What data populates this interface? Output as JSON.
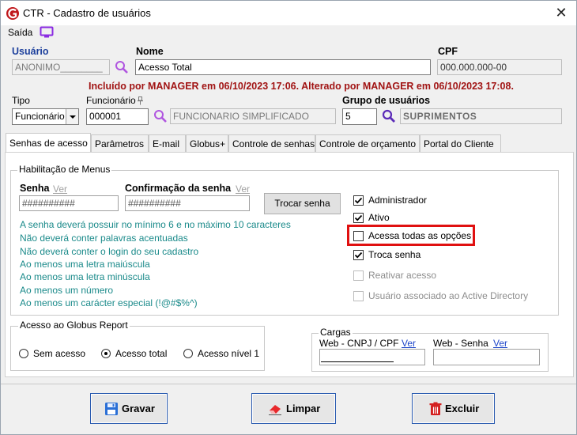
{
  "window": {
    "title": "CTR - Cadastro de usuários"
  },
  "menu": {
    "exit_label": "Saída"
  },
  "header": {
    "usuario_label": "Usuário",
    "usuario_value": "ANONIMO________",
    "nome_label": "Nome",
    "nome_value": "Acesso Total",
    "cpf_label": "CPF",
    "cpf_value": "000.000.000-00",
    "audit_text": "Incluído por MANAGER em 06/10/2023 17:06. Alterado por MANAGER em 06/10/2023 17:08.",
    "tipo_label": "Tipo",
    "tipo_value": "Funcionário",
    "funcionario_label": "Funcionário",
    "funcionario_code": "000001",
    "funcionario_name": "FUNCIONARIO SIMPLIFICADO",
    "grupo_label": "Grupo de usuários",
    "grupo_code": "5",
    "grupo_name": "SUPRIMENTOS"
  },
  "tabs": [
    {
      "label": "Senhas de acesso"
    },
    {
      "label": "Parâmetros"
    },
    {
      "label": "E-mail"
    },
    {
      "label": "Globus+"
    },
    {
      "label": "Controle de senhas"
    },
    {
      "label": "Controle de orçamento"
    },
    {
      "label": "Portal do Cliente"
    }
  ],
  "senhas": {
    "group_title": "Habilitação de Menus",
    "senha_label": "Senha",
    "senha_ver": "Ver",
    "senha_value": "##########",
    "confirm_label": "Confirmação da senha",
    "confirm_ver": "Ver",
    "confirm_value": "##########",
    "trocar_button": "Trocar senha",
    "hints": [
      "A senha deverá possuir no mínimo 6 e no máximo 10 caracteres",
      "Não deverá conter palavras acentuadas",
      "Não deverá conter o login do seu cadastro",
      "Ao menos uma letra maiúscula",
      "Ao menos uma letra minúscula",
      "Ao menos um número",
      "Ao menos um carácter especial (!@#$%^)"
    ],
    "checkboxes": [
      {
        "label": "Administrador",
        "checked": true,
        "enabled": true
      },
      {
        "label": "Ativo",
        "checked": true,
        "enabled": true
      },
      {
        "label": "Acessa todas as opções",
        "checked": false,
        "enabled": true
      },
      {
        "label": "Troca senha",
        "checked": true,
        "enabled": true
      },
      {
        "label": "Reativar acesso",
        "checked": false,
        "enabled": false
      },
      {
        "label": "Usuário associado ao Active Directory",
        "checked": false,
        "enabled": false
      }
    ]
  },
  "globus_report": {
    "title": "Acesso ao Globus Report",
    "options": [
      {
        "label": "Sem acesso",
        "selected": false
      },
      {
        "label": "Acesso total",
        "selected": true
      },
      {
        "label": "Acesso nível 1",
        "selected": false
      }
    ]
  },
  "cargas": {
    "title": "Cargas",
    "cnpj_label": "Web - CNPJ / CPF",
    "cnpj_ver": "Ver",
    "cnpj_value": "",
    "senha_label": "Web - Senha",
    "senha_ver": "Ver",
    "senha_value": ""
  },
  "footer": {
    "gravar": "Gravar",
    "limpar": "Limpar",
    "excluir": "Excluir"
  },
  "colors": {
    "audit_red": "#a11414",
    "hint_teal": "#1a8a8a",
    "label_blue": "#1c3f9c",
    "highlight_red": "#e01010",
    "search_purple": "#a040d0"
  }
}
